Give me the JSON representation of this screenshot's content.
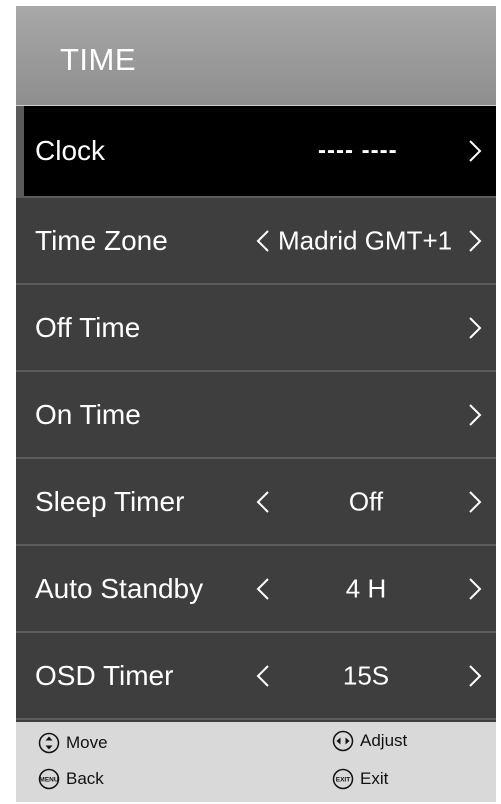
{
  "menu": {
    "title": "TIME",
    "rows": [
      {
        "label": "Clock",
        "value": "---- ----",
        "selected": true
      },
      {
        "label": "Time Zone",
        "value": "Madrid GMT+1"
      },
      {
        "label": "Off Time"
      },
      {
        "label": "On Time"
      },
      {
        "label": "Sleep Timer",
        "value": "Off"
      },
      {
        "label": "Auto Standby",
        "value": "4 H"
      },
      {
        "label": "OSD Timer",
        "value": "15S"
      }
    ]
  },
  "footer": {
    "move": "Move",
    "adjust": "Adjust",
    "back": "Back",
    "exit": "Exit",
    "menu_key": "MENU",
    "exit_key": "EXIT"
  },
  "colors": {
    "panel": "#3e3e3e",
    "header": "#999999",
    "selected_row": "#000000",
    "footer": "#d9d9d9",
    "text": "#ffffff"
  }
}
